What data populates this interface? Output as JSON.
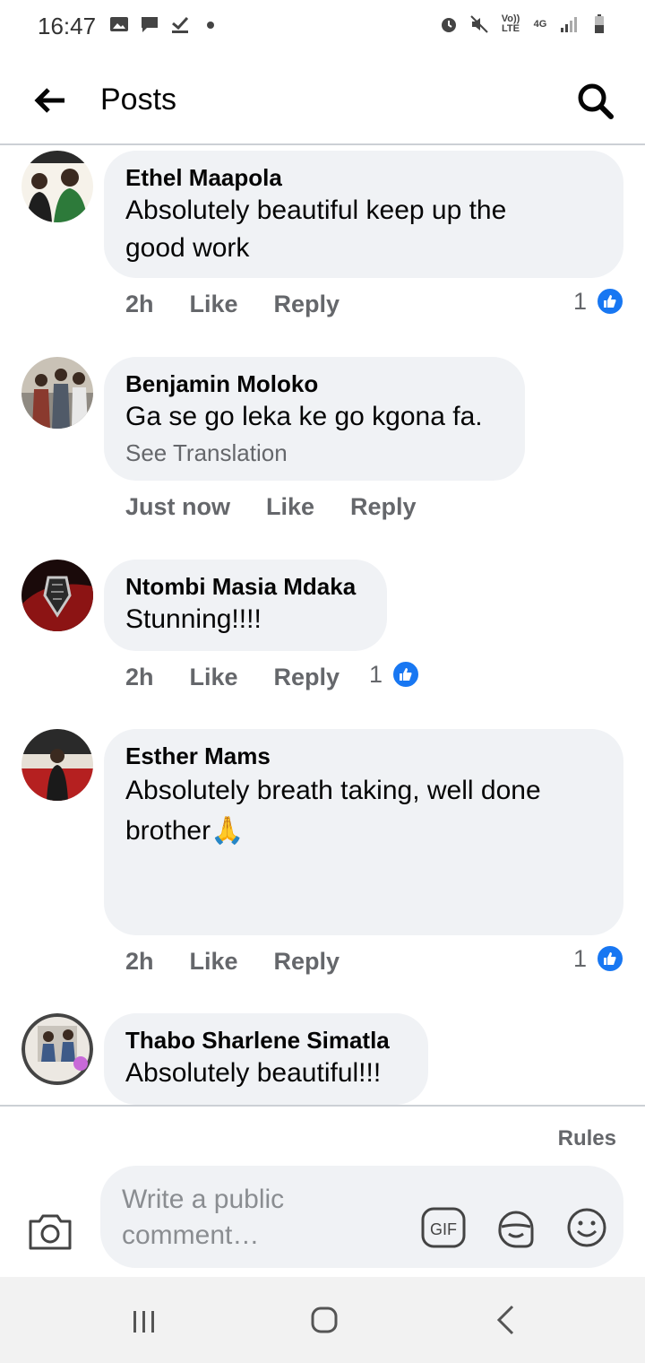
{
  "status_bar": {
    "time": "16:47",
    "left_icons": [
      "image-icon",
      "message-icon",
      "check-download-icon",
      "dot-icon"
    ],
    "right_icons": [
      "alarm-icon",
      "mute-icon",
      "volte-icon",
      "4g-icon",
      "signal-icon",
      "battery-icon"
    ],
    "volte_label": "Vo)) LTE",
    "network_label": "4G"
  },
  "header": {
    "title": "Posts",
    "back_icon": "arrow-left-icon",
    "search_icon": "search-icon"
  },
  "comments": [
    {
      "author": "Ethel Maapola",
      "text": "Absolutely beautiful keep up the good work",
      "time": "2h",
      "like_label": "Like",
      "reply_label": "Reply",
      "reaction_count": "1"
    },
    {
      "author": "Benjamin Moloko",
      "text": "Ga se go leka ke go kgona fa.",
      "see_translation": "See Translation",
      "time": "Just now",
      "like_label": "Like",
      "reply_label": "Reply"
    },
    {
      "author": "Ntombi Masia Mdaka",
      "text": "Stunning!!!!",
      "time": "2h",
      "like_label": "Like",
      "reply_label": "Reply",
      "reaction_count": "1"
    },
    {
      "author": "Esther Mams",
      "text": "Absolutely breath taking, well done brother🙏",
      "time": "2h",
      "like_label": "Like",
      "reply_label": "Reply",
      "reaction_count": "1"
    },
    {
      "author": "Thabo Sharlene Simatla",
      "text": "Absolutely beautiful!!!"
    }
  ],
  "footer": {
    "rules_label": "Rules",
    "comment_placeholder": "Write a public comment…",
    "gif_label": "GIF"
  },
  "colors": {
    "accent": "#1877f2",
    "bubble": "#f0f2f5",
    "secondary_text": "#65676b"
  }
}
